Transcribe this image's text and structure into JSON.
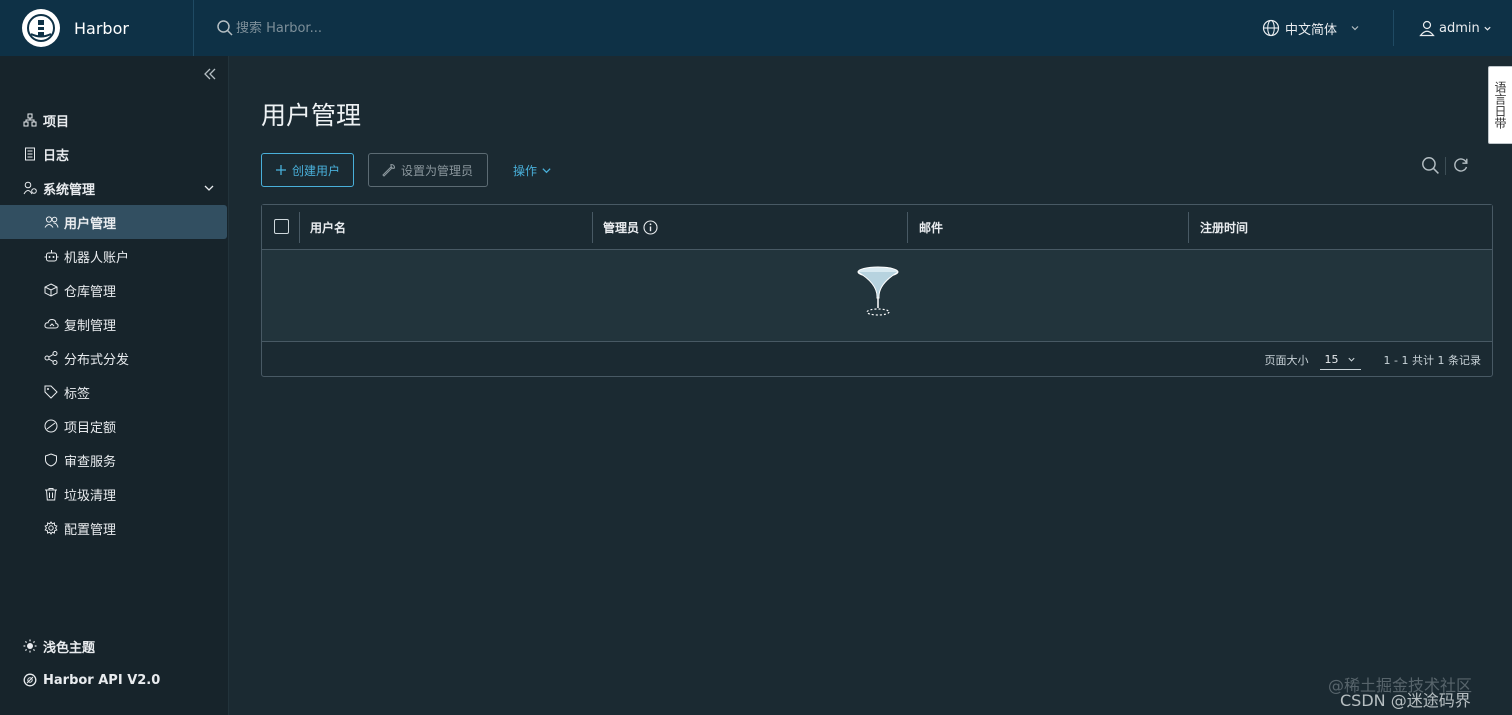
{
  "header": {
    "brand": "Harbor",
    "search_placeholder": "搜索 Harbor...",
    "language": "中文简体",
    "user": "admin"
  },
  "sidebar": {
    "items": [
      {
        "label": "项目",
        "icon": "project-icon"
      },
      {
        "label": "日志",
        "icon": "log-icon"
      },
      {
        "label": "系统管理",
        "icon": "admin-icon"
      }
    ],
    "sub_items": [
      {
        "label": "用户管理",
        "icon": "users-icon",
        "active": true
      },
      {
        "label": "机器人账户",
        "icon": "robot-icon"
      },
      {
        "label": "仓库管理",
        "icon": "registry-icon"
      },
      {
        "label": "复制管理",
        "icon": "replication-icon"
      },
      {
        "label": "分布式分发",
        "icon": "distribution-icon"
      },
      {
        "label": "标签",
        "icon": "tag-icon"
      },
      {
        "label": "项目定额",
        "icon": "quota-icon"
      },
      {
        "label": "审查服务",
        "icon": "shield-icon"
      },
      {
        "label": "垃圾清理",
        "icon": "trash-icon"
      },
      {
        "label": "配置管理",
        "icon": "gear-icon"
      }
    ],
    "footer": {
      "theme": "浅色主题",
      "api": "Harbor API V2.0"
    }
  },
  "main": {
    "title": "用户管理",
    "create_button": "创建用户",
    "set_admin_button": "设置为管理员",
    "actions_label": "操作",
    "table": {
      "columns": [
        "用户名",
        "管理员",
        "邮件",
        "注册时间"
      ]
    },
    "pagination": {
      "page_size_label": "页面大小",
      "page_size": "15",
      "summary": "1 - 1 共计 1 条记录"
    }
  },
  "float_tab": "语言日带",
  "watermark": {
    "line1": "@稀土掘金技术社区",
    "line2": "CSDN @迷途码界"
  },
  "colors": {
    "header_bg": "#0e3146",
    "sidebar_bg": "#17242b",
    "content_bg": "#1b2a32",
    "accent": "#49afd9",
    "active_nav": "#324f61"
  }
}
